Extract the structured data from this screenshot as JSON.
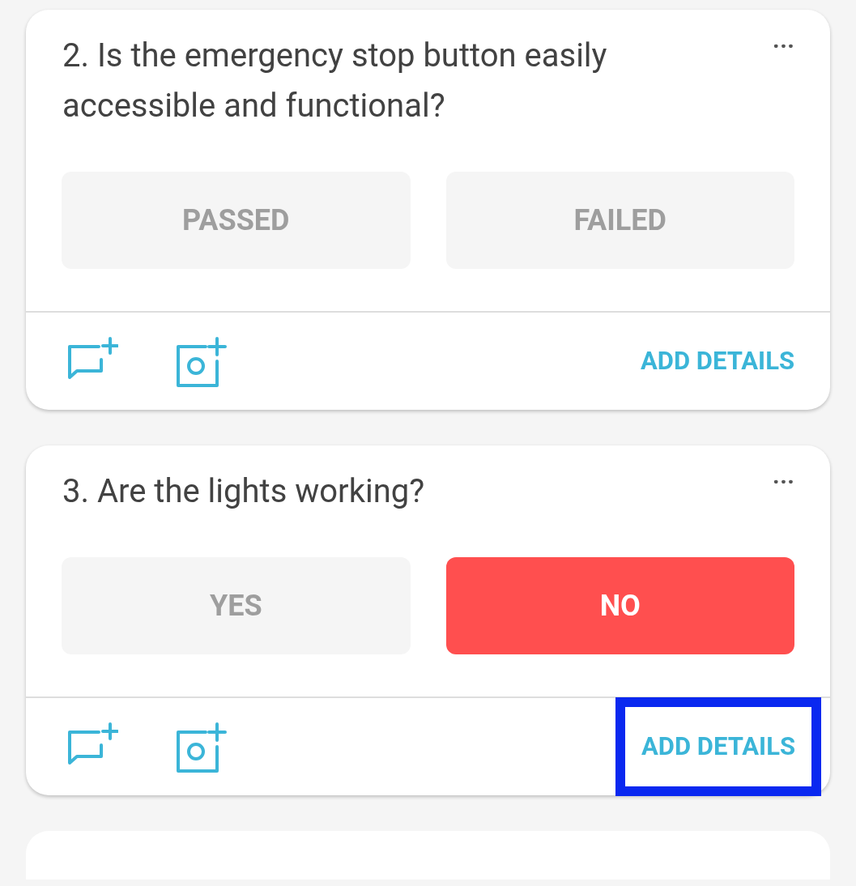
{
  "questions": [
    {
      "title": "2. Is the emergency stop button easily accessible and functional?",
      "menu": "···",
      "options": [
        {
          "label": "PASSED",
          "selected": false
        },
        {
          "label": "FAILED",
          "selected": false
        }
      ],
      "details": {
        "label": "ADD DETAILS",
        "highlighted": false
      }
    },
    {
      "title": "3. Are the lights working?",
      "menu": "···",
      "options": [
        {
          "label": "YES",
          "selected": false
        },
        {
          "label": "NO",
          "selected": true
        }
      ],
      "details": {
        "label": "ADD DETAILS",
        "highlighted": true
      }
    }
  ],
  "next_card_partial": true
}
